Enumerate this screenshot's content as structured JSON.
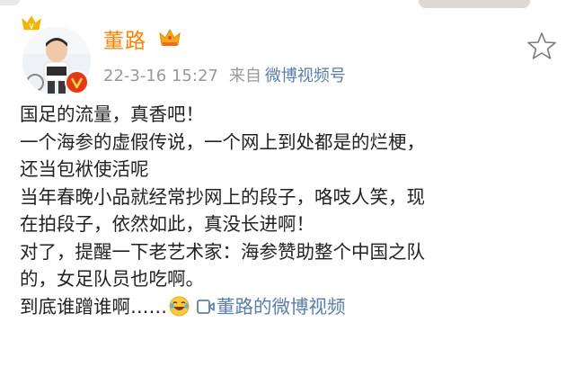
{
  "post": {
    "author": "董路",
    "timestamp": "22-3-16 15:27",
    "source_label": "来自",
    "source": "微博视频号",
    "lines": [
      "国足的流量，真香吧！",
      "一个海参的虚假传说，一个网上到处都是的烂梗，",
      "还当包袱使活呢",
      "当年春晚小品就经常抄网上的段子，咯吱人笑，现",
      "在拍段子，依然如此，真没长进啊！",
      "对了，提醒一下老艺术家：海参赞助整个中国之队",
      "的，女足队员也吃啊。"
    ],
    "last_line_text": "到底谁蹭谁啊……",
    "video_link": "董路的微博视频"
  },
  "icons": {
    "rank_badge": "rank-badge-icon",
    "verified": "verified-badge-icon",
    "crown": "crown-icon",
    "favorite": "star-icon",
    "emoji": "laughing-tears-emoji-icon",
    "video": "video-icon"
  },
  "colors": {
    "username": "#ff8200",
    "meta": "#999999",
    "link": "#5b7ea8",
    "text": "#222222"
  }
}
